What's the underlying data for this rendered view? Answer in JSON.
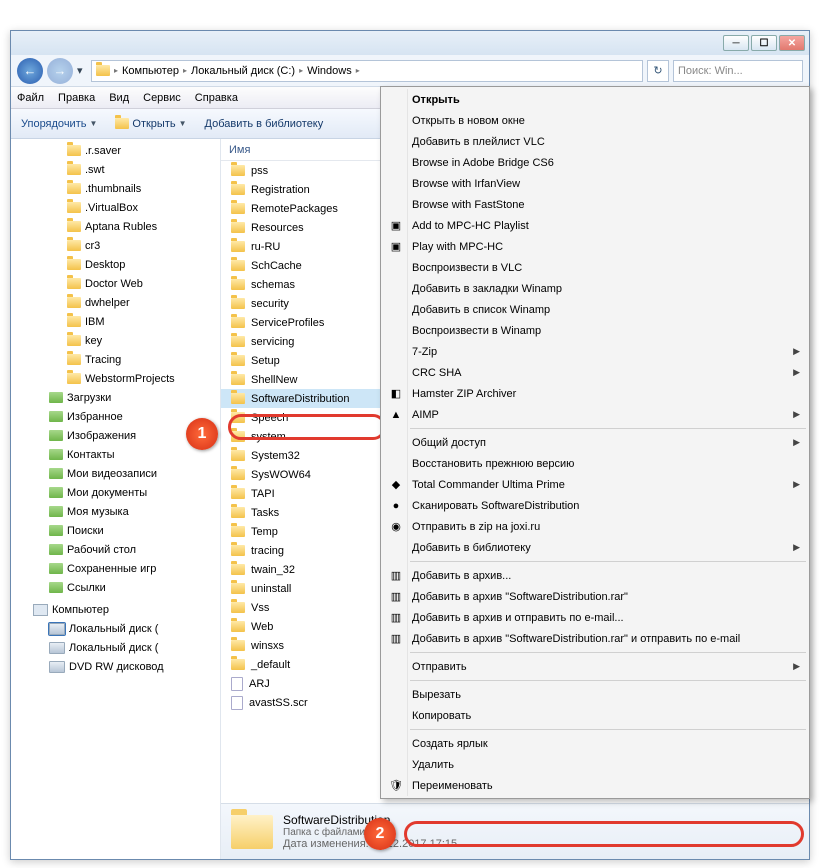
{
  "title_buttons": {
    "min": "─",
    "max": "☐",
    "close": "✕"
  },
  "breadcrumb": {
    "computer": "Компьютер",
    "drive": "Локальный диск (C:)",
    "folder": "Windows"
  },
  "search_placeholder": "Поиск: Win...",
  "menu": {
    "file": "Файл",
    "edit": "Правка",
    "view": "Вид",
    "service": "Сервис",
    "help": "Справка"
  },
  "cmdbar": {
    "organize": "Упорядочить",
    "open": "Открыть",
    "add_lib": "Добавить в библиотеку"
  },
  "header_name": "Имя",
  "sidebar_folders": [
    ".r.saver",
    ".swt",
    ".thumbnails",
    ".VirtualBox",
    "Aptana Rubles",
    "cr3",
    "Desktop",
    "Doctor Web",
    "dwhelper",
    "IBM",
    "key",
    "Tracing",
    "WebstormProjects"
  ],
  "sidebar_sys": [
    "Загрузки",
    "Избранное",
    "Изображения",
    "Контакты",
    "Мои видеозаписи",
    "Мои документы",
    "Моя музыка",
    "Поиски",
    "Рабочий стол",
    "Сохраненные игр",
    "Ссылки"
  ],
  "sidebar_computer": "Компьютер",
  "sidebar_drives": [
    "Локальный диск (",
    "Локальный диск (",
    "DVD RW дисковод"
  ],
  "list_first": "pss",
  "list_folders": [
    "Registration",
    "RemotePackages",
    "Resources",
    "ru-RU",
    "SchCache",
    "schemas",
    "security",
    "ServiceProfiles",
    "servicing",
    "Setup",
    "ShellNew"
  ],
  "list_selected": "SoftwareDistribution",
  "list_after": [
    "Speech",
    "system",
    "System32",
    "SysWOW64",
    "TAPI",
    "Tasks",
    "Temp",
    "tracing",
    "twain_32",
    "uninstall",
    "Vss",
    "Web",
    "winsxs",
    "_default"
  ],
  "list_files": [
    "ARJ",
    "avastSS.scr"
  ],
  "details": {
    "name": "SoftwareDistribution",
    "type": "Папка с файлами",
    "mod_label": "Дата изменения:",
    "mod_value": "16.12.2017 17:15"
  },
  "ctx": {
    "open": "Открыть",
    "open_new": "Открыть в новом окне",
    "vlc_playlist": "Добавить в плейлист VLC",
    "bridge": "Browse in Adobe Bridge CS6",
    "irfan": "Browse with IrfanView",
    "faststone": "Browse with FastStone",
    "mpc_add": "Add to MPC-HC Playlist",
    "mpc_play": "Play with MPC-HC",
    "vlc_play": "Воспроизвести в VLC",
    "winamp_book": "Добавить в закладки Winamp",
    "winamp_add": "Добавить в список Winamp",
    "winamp_play": "Воспроизвести в Winamp",
    "7zip": "7-Zip",
    "crc": "CRC SHA",
    "hamster": "Hamster ZIP Archiver",
    "aimp": "AIMP",
    "share": "Общий доступ",
    "restore": "Восстановить прежнюю версию",
    "tcup": "Total Commander Ultima Prime",
    "scan": "Сканировать SoftwareDistribution",
    "joxi": "Отправить в zip на joxi.ru",
    "addlib": "Добавить в библиотеку",
    "arch1": "Добавить в архив...",
    "arch2": "Добавить в архив \"SoftwareDistribution.rar\"",
    "arch3": "Добавить в архив и отправить по e-mail...",
    "arch4": "Добавить в архив \"SoftwareDistribution.rar\" и отправить по e-mail",
    "sendto": "Отправить",
    "cut": "Вырезать",
    "copy": "Копировать",
    "shortcut": "Создать ярлык",
    "delete": "Удалить",
    "rename": "Переименовать"
  },
  "callouts": {
    "one": "1",
    "two": "2"
  }
}
